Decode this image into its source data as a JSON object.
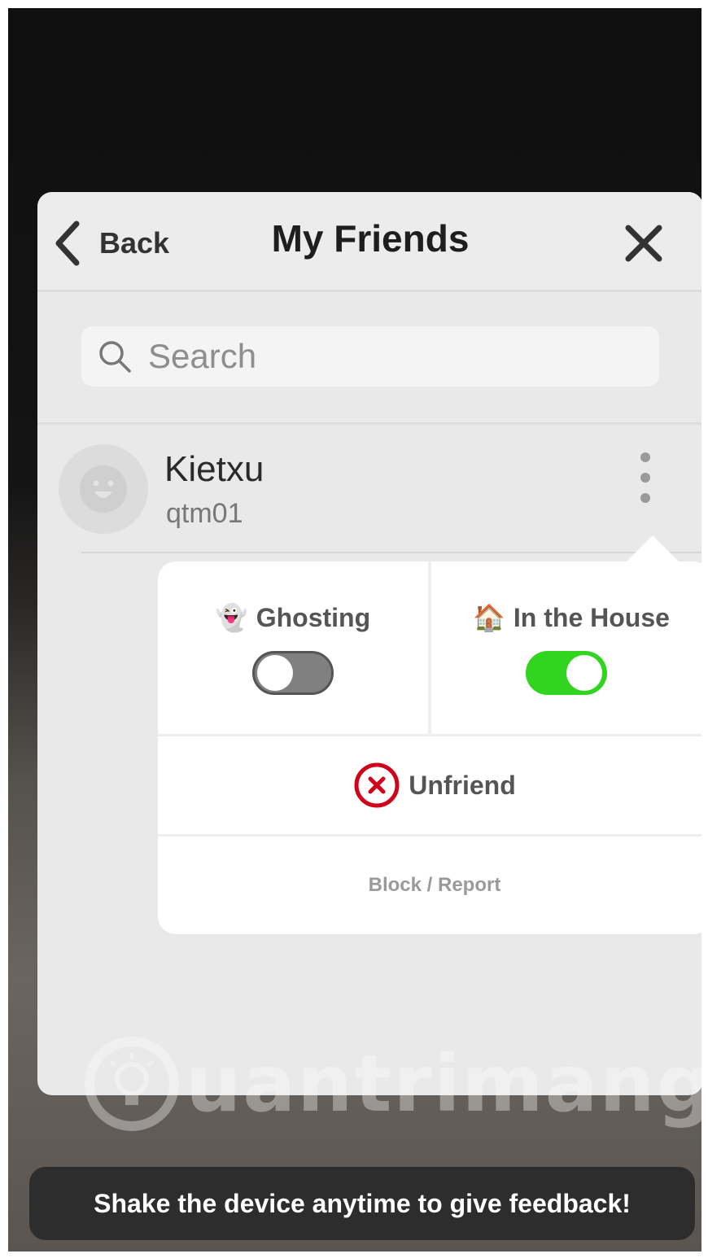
{
  "header": {
    "back_label": "Back",
    "title": "My Friends",
    "back_icon": "chevron-left-icon",
    "close_icon": "close-icon"
  },
  "search": {
    "placeholder": "Search",
    "value": "",
    "icon": "search-icon"
  },
  "friend": {
    "name": "Kietxu",
    "username": "qtm01",
    "avatar_icon": "smiley-avatar-icon",
    "more_icon": "more-vertical-icon"
  },
  "menu": {
    "ghosting": {
      "emoji": "👻",
      "label": "Ghosting",
      "enabled": false
    },
    "in_the_house": {
      "emoji": "🏠",
      "label": "In the House",
      "enabled": true
    },
    "unfriend_label": "Unfriend",
    "block_report_label": "Block / Report"
  },
  "watermark": {
    "text": "uantrimang",
    "icon": "lightbulb-icon"
  },
  "toast": {
    "text": "Shake the device anytime to give feedback!"
  },
  "colors": {
    "toggle_on": "#31d41f",
    "toggle_off": "#808080",
    "unfriend_red": "#d0021b"
  }
}
